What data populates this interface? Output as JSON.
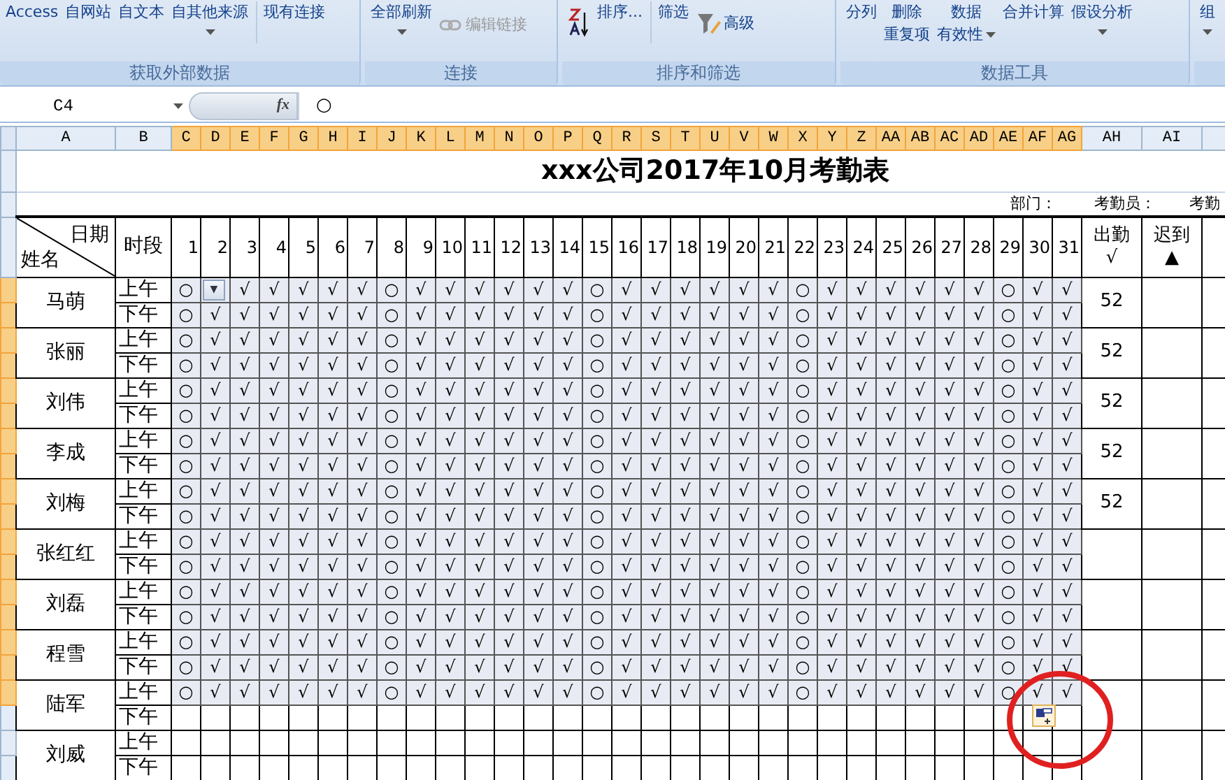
{
  "ribbon": {
    "groups": [
      {
        "label": "获取外部数据",
        "buttons": [
          {
            "label": "Access"
          },
          {
            "label": "自网站"
          },
          {
            "label": "自文本"
          },
          {
            "label": "自其他来源",
            "caret": true
          },
          {
            "label": "现有连接",
            "separator": true
          }
        ]
      },
      {
        "label": "连接",
        "buttons": [
          {
            "label": "全部刷新",
            "caret": true
          },
          {
            "label": "编辑链接",
            "disabled": true,
            "kind": "link"
          }
        ]
      },
      {
        "label": "排序和筛选",
        "buttons": [
          {
            "kind": "sort"
          },
          {
            "label": "排序..."
          },
          {
            "label": "筛选",
            "separator": true
          },
          {
            "label": "高级",
            "kind": "filter"
          }
        ]
      },
      {
        "label": "数据工具",
        "buttons": [
          {
            "label": "分列"
          },
          {
            "label": "删除",
            "label2": "重复项"
          },
          {
            "label": "数据",
            "label2": "有效性",
            "caret": true
          },
          {
            "label": "合并计算"
          },
          {
            "label": "假设分析",
            "caret": true
          }
        ]
      },
      {
        "buttons": [
          {
            "label": "组",
            "caret": true
          }
        ]
      }
    ]
  },
  "formula_bar": {
    "name_box": "C4",
    "fx_label": "fx",
    "value": "○"
  },
  "columns": [
    {
      "label": "A",
      "selected": false
    },
    {
      "label": "B",
      "selected": false
    },
    {
      "label": "C",
      "selected": true
    },
    {
      "label": "D",
      "selected": true
    },
    {
      "label": "E",
      "selected": true
    },
    {
      "label": "F",
      "selected": true
    },
    {
      "label": "G",
      "selected": true
    },
    {
      "label": "H",
      "selected": true
    },
    {
      "label": "I",
      "selected": true
    },
    {
      "label": "J",
      "selected": true
    },
    {
      "label": "K",
      "selected": true
    },
    {
      "label": "L",
      "selected": true
    },
    {
      "label": "M",
      "selected": true
    },
    {
      "label": "N",
      "selected": true
    },
    {
      "label": "O",
      "selected": true
    },
    {
      "label": "P",
      "selected": true
    },
    {
      "label": "Q",
      "selected": true
    },
    {
      "label": "R",
      "selected": true
    },
    {
      "label": "S",
      "selected": true
    },
    {
      "label": "T",
      "selected": true
    },
    {
      "label": "U",
      "selected": true
    },
    {
      "label": "V",
      "selected": true
    },
    {
      "label": "W",
      "selected": true
    },
    {
      "label": "X",
      "selected": true
    },
    {
      "label": "Y",
      "selected": true
    },
    {
      "label": "Z",
      "selected": true
    },
    {
      "label": "AA",
      "selected": true
    },
    {
      "label": "AB",
      "selected": true
    },
    {
      "label": "AC",
      "selected": true
    },
    {
      "label": "AD",
      "selected": true
    },
    {
      "label": "AE",
      "selected": true
    },
    {
      "label": "AF",
      "selected": true
    },
    {
      "label": "AG",
      "selected": true
    },
    {
      "label": "AH",
      "selected": false
    },
    {
      "label": "AI",
      "selected": false
    }
  ],
  "sheet": {
    "title": "xxx公司2017年10月考勤表",
    "department_label": "部门：",
    "clerk_label": "考勤员：",
    "cut_label": "考勤",
    "corner_top": "日期",
    "corner_bottom": "姓名",
    "period_header": "时段",
    "days": [
      "1",
      "2",
      "3",
      "4",
      "5",
      "6",
      "7",
      "8",
      "9",
      "10",
      "11",
      "12",
      "13",
      "14",
      "15",
      "16",
      "17",
      "18",
      "19",
      "20",
      "21",
      "22",
      "23",
      "24",
      "25",
      "26",
      "27",
      "28",
      "29",
      "30",
      "31"
    ],
    "present_header": "出勤",
    "present_symbol": "√",
    "late_header": "迟到",
    "late_symbol": "▲",
    "people": [
      {
        "name": "马萌",
        "attendance": "52",
        "periods": [
          {
            "label": "上午",
            "selected": true,
            "dropdown": true,
            "marks": [
              "○",
              "▼",
              "√",
              "√",
              "√",
              "√",
              "√",
              "○",
              "√",
              "√",
              "√",
              "√",
              "√",
              "√",
              "○",
              "√",
              "√",
              "√",
              "√",
              "√",
              "√",
              "○",
              "√",
              "√",
              "√",
              "√",
              "√",
              "√",
              "○",
              "√",
              "√"
            ]
          },
          {
            "label": "下午",
            "selected": true,
            "marks": [
              "○",
              "√",
              "√",
              "√",
              "√",
              "√",
              "√",
              "○",
              "√",
              "√",
              "√",
              "√",
              "√",
              "√",
              "○",
              "√",
              "√",
              "√",
              "√",
              "√",
              "√",
              "○",
              "√",
              "√",
              "√",
              "√",
              "√",
              "√",
              "○",
              "√",
              "√"
            ]
          }
        ]
      },
      {
        "name": "张丽",
        "attendance": "52",
        "periods": [
          {
            "label": "上午",
            "selected": true,
            "marks": [
              "○",
              "√",
              "√",
              "√",
              "√",
              "√",
              "√",
              "○",
              "√",
              "√",
              "√",
              "√",
              "√",
              "√",
              "○",
              "√",
              "√",
              "√",
              "√",
              "√",
              "√",
              "○",
              "√",
              "√",
              "√",
              "√",
              "√",
              "√",
              "○",
              "√",
              "√"
            ]
          },
          {
            "label": "下午",
            "selected": true,
            "marks": [
              "○",
              "√",
              "√",
              "√",
              "√",
              "√",
              "√",
              "○",
              "√",
              "√",
              "√",
              "√",
              "√",
              "√",
              "○",
              "√",
              "√",
              "√",
              "√",
              "√",
              "√",
              "○",
              "√",
              "√",
              "√",
              "√",
              "√",
              "√",
              "○",
              "√",
              "√"
            ]
          }
        ]
      },
      {
        "name": "刘伟",
        "attendance": "52",
        "periods": [
          {
            "label": "上午",
            "selected": true,
            "marks": [
              "○",
              "√",
              "√",
              "√",
              "√",
              "√",
              "√",
              "○",
              "√",
              "√",
              "√",
              "√",
              "√",
              "√",
              "○",
              "√",
              "√",
              "√",
              "√",
              "√",
              "√",
              "○",
              "√",
              "√",
              "√",
              "√",
              "√",
              "√",
              "○",
              "√",
              "√"
            ]
          },
          {
            "label": "下午",
            "selected": true,
            "marks": [
              "○",
              "√",
              "√",
              "√",
              "√",
              "√",
              "√",
              "○",
              "√",
              "√",
              "√",
              "√",
              "√",
              "√",
              "○",
              "√",
              "√",
              "√",
              "√",
              "√",
              "√",
              "○",
              "√",
              "√",
              "√",
              "√",
              "√",
              "√",
              "○",
              "√",
              "√"
            ]
          }
        ]
      },
      {
        "name": "李成",
        "attendance": "52",
        "periods": [
          {
            "label": "上午",
            "selected": true,
            "marks": [
              "○",
              "√",
              "√",
              "√",
              "√",
              "√",
              "√",
              "○",
              "√",
              "√",
              "√",
              "√",
              "√",
              "√",
              "○",
              "√",
              "√",
              "√",
              "√",
              "√",
              "√",
              "○",
              "√",
              "√",
              "√",
              "√",
              "√",
              "√",
              "○",
              "√",
              "√"
            ]
          },
          {
            "label": "下午",
            "selected": true,
            "marks": [
              "○",
              "√",
              "√",
              "√",
              "√",
              "√",
              "√",
              "○",
              "√",
              "√",
              "√",
              "√",
              "√",
              "√",
              "○",
              "√",
              "√",
              "√",
              "√",
              "√",
              "√",
              "○",
              "√",
              "√",
              "√",
              "√",
              "√",
              "√",
              "○",
              "√",
              "√"
            ]
          }
        ]
      },
      {
        "name": "刘梅",
        "attendance": "52",
        "periods": [
          {
            "label": "上午",
            "selected": true,
            "marks": [
              "○",
              "√",
              "√",
              "√",
              "√",
              "√",
              "√",
              "○",
              "√",
              "√",
              "√",
              "√",
              "√",
              "√",
              "○",
              "√",
              "√",
              "√",
              "√",
              "√",
              "√",
              "○",
              "√",
              "√",
              "√",
              "√",
              "√",
              "√",
              "○",
              "√",
              "√"
            ]
          },
          {
            "label": "下午",
            "selected": true,
            "marks": [
              "○",
              "√",
              "√",
              "√",
              "√",
              "√",
              "√",
              "○",
              "√",
              "√",
              "√",
              "√",
              "√",
              "√",
              "○",
              "√",
              "√",
              "√",
              "√",
              "√",
              "√",
              "○",
              "√",
              "√",
              "√",
              "√",
              "√",
              "√",
              "○",
              "√",
              "√"
            ]
          }
        ]
      },
      {
        "name": "张红红",
        "periods": [
          {
            "label": "上午",
            "selected": true,
            "marks": [
              "○",
              "√",
              "√",
              "√",
              "√",
              "√",
              "√",
              "○",
              "√",
              "√",
              "√",
              "√",
              "√",
              "√",
              "○",
              "√",
              "√",
              "√",
              "√",
              "√",
              "√",
              "○",
              "√",
              "√",
              "√",
              "√",
              "√",
              "√",
              "○",
              "√",
              "√"
            ]
          },
          {
            "label": "下午",
            "selected": true,
            "marks": [
              "○",
              "√",
              "√",
              "√",
              "√",
              "√",
              "√",
              "○",
              "√",
              "√",
              "√",
              "√",
              "√",
              "√",
              "○",
              "√",
              "√",
              "√",
              "√",
              "√",
              "√",
              "○",
              "√",
              "√",
              "√",
              "√",
              "√",
              "√",
              "○",
              "√",
              "√"
            ]
          }
        ]
      },
      {
        "name": "刘磊",
        "periods": [
          {
            "label": "上午",
            "selected": true,
            "marks": [
              "○",
              "√",
              "√",
              "√",
              "√",
              "√",
              "√",
              "○",
              "√",
              "√",
              "√",
              "√",
              "√",
              "√",
              "○",
              "√",
              "√",
              "√",
              "√",
              "√",
              "√",
              "○",
              "√",
              "√",
              "√",
              "√",
              "√",
              "√",
              "○",
              "√",
              "√"
            ]
          },
          {
            "label": "下午",
            "selected": true,
            "marks": [
              "○",
              "√",
              "√",
              "√",
              "√",
              "√",
              "√",
              "○",
              "√",
              "√",
              "√",
              "√",
              "√",
              "√",
              "○",
              "√",
              "√",
              "√",
              "√",
              "√",
              "√",
              "○",
              "√",
              "√",
              "√",
              "√",
              "√",
              "√",
              "○",
              "√",
              "√"
            ]
          }
        ]
      },
      {
        "name": "程雪",
        "periods": [
          {
            "label": "上午",
            "selected": true,
            "marks": [
              "○",
              "√",
              "√",
              "√",
              "√",
              "√",
              "√",
              "○",
              "√",
              "√",
              "√",
              "√",
              "√",
              "√",
              "○",
              "√",
              "√",
              "√",
              "√",
              "√",
              "√",
              "○",
              "√",
              "√",
              "√",
              "√",
              "√",
              "√",
              "○",
              "√",
              "√"
            ]
          },
          {
            "label": "下午",
            "selected": true,
            "marks": [
              "○",
              "√",
              "√",
              "√",
              "√",
              "√",
              "√",
              "○",
              "√",
              "√",
              "√",
              "√",
              "√",
              "√",
              "○",
              "√",
              "√",
              "√",
              "√",
              "√",
              "√",
              "○",
              "√",
              "√",
              "√",
              "√",
              "√",
              "√",
              "○",
              "√",
              "√"
            ]
          }
        ]
      },
      {
        "name": "陆军",
        "periods": [
          {
            "label": "上午",
            "selected": true,
            "marks": [
              "○",
              "√",
              "√",
              "√",
              "√",
              "√",
              "√",
              "○",
              "√",
              "√",
              "√",
              "√",
              "√",
              "√",
              "○",
              "√",
              "√",
              "√",
              "√",
              "√",
              "√",
              "○",
              "√",
              "√",
              "√",
              "√",
              "√",
              "√",
              "○",
              "√",
              "√"
            ]
          },
          {
            "label": "下午",
            "selected": false
          }
        ]
      },
      {
        "name": "刘威",
        "periods": [
          {
            "label": "上午",
            "selected": false
          },
          {
            "label": "下午",
            "selected": false
          }
        ]
      }
    ]
  }
}
